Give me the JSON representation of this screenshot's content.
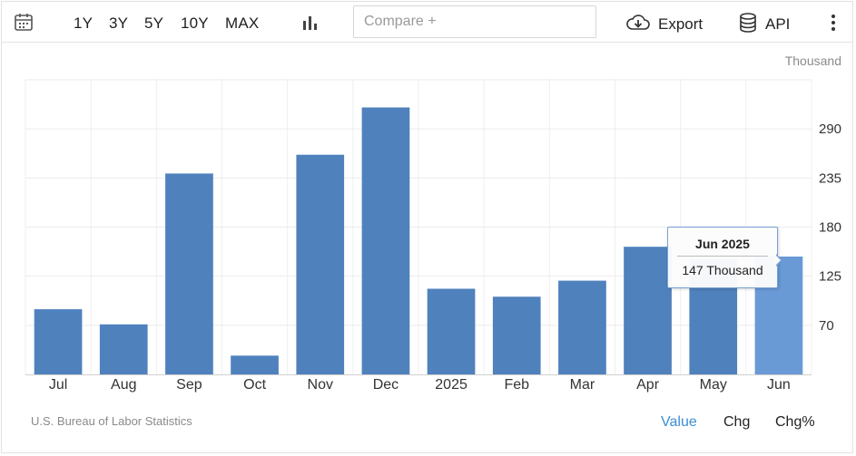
{
  "toolbar": {
    "ranges": [
      "1Y",
      "3Y",
      "5Y",
      "10Y",
      "MAX"
    ],
    "compare_placeholder": "Compare +",
    "export_label": "Export",
    "api_label": "API",
    "icons": {
      "calendar": "calendar-icon",
      "chart_type": "bar-chart-icon",
      "export": "cloud-download-icon",
      "api": "database-icon",
      "more": "more-vertical-icon"
    }
  },
  "chart_data": {
    "type": "bar",
    "unit_label": "Thousand",
    "categories": [
      "Jul",
      "Aug",
      "Sep",
      "Oct",
      "Nov",
      "Dec",
      "2025",
      "Feb",
      "Mar",
      "Apr",
      "May",
      "Jun"
    ],
    "values": [
      88,
      71,
      240,
      36,
      261,
      314,
      111,
      102,
      120,
      158,
      144,
      147
    ],
    "ylim": [
      15,
      345
    ],
    "yticks": [
      70,
      125,
      180,
      235,
      290
    ],
    "grid": true,
    "highlight_index": 11,
    "bar_color": "#4f81bd",
    "highlight_color": "#6a9ad6"
  },
  "tooltip": {
    "title": "Jun 2025",
    "value": "147 Thousand"
  },
  "footer": {
    "source": "U.S. Bureau of Labor Statistics",
    "tabs": [
      "Value",
      "Chg",
      "Chg%"
    ],
    "active_tab": "Value",
    "active_color": "#3b8fd4"
  }
}
